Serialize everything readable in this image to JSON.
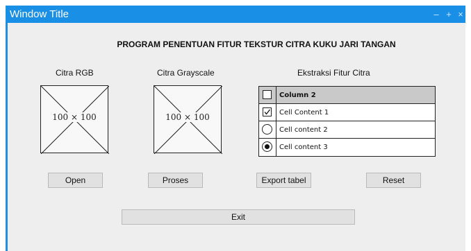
{
  "window": {
    "title": "Window Title",
    "minimize_icon": "minimize-icon",
    "maximize_icon": "maximize-icon",
    "close_icon": "close-icon"
  },
  "heading": "PROGRAM PENENTUAN FITUR TEKSTUR CITRA KUKU JARI TANGAN",
  "panels": {
    "rgb": {
      "label": "Citra RGB",
      "placeholder": "100 × 100"
    },
    "grayscale": {
      "label": "Citra Grayscale",
      "placeholder": "100 × 100"
    },
    "fitur": {
      "label": "Ekstraksi Fitur Citra"
    }
  },
  "table": {
    "header": "Column 2",
    "rows": [
      {
        "text": "Cell Content 1",
        "control": "checkbox",
        "checked": true
      },
      {
        "text": "Cell content 2",
        "control": "radio",
        "checked": false
      },
      {
        "text": "Cell content 3",
        "control": "radio",
        "checked": true
      }
    ]
  },
  "buttons": {
    "open": "Open",
    "proses": "Proses",
    "export": "Export tabel",
    "reset": "Reset",
    "exit": "Exit"
  },
  "colors": {
    "titlebar": "#1a8fe6",
    "background": "#eeeeee",
    "button": "#e1e1e1",
    "table_header": "#c9c9c9"
  }
}
